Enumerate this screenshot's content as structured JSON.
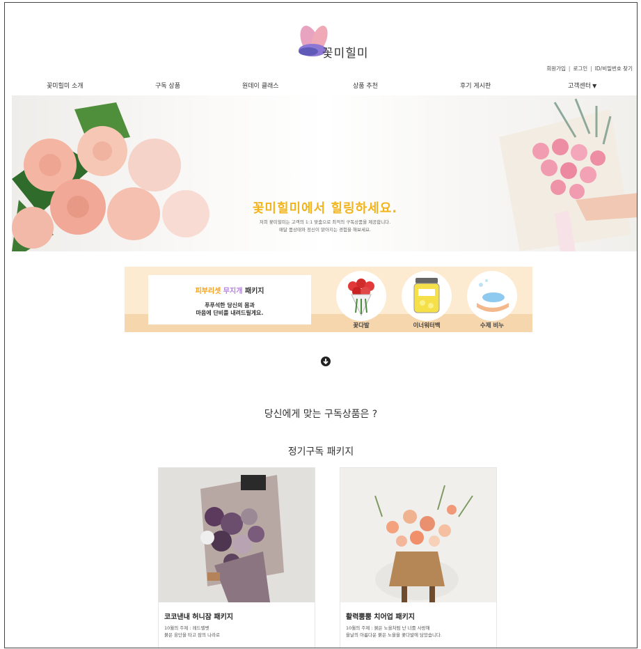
{
  "brand": {
    "name": "꽃미힐미"
  },
  "top_links": [
    "회원가입",
    "로그인",
    "ID/비밀번호 찾기"
  ],
  "nav": {
    "items": [
      "꽃미힐미 소개",
      "구독 상품",
      "원데이 클래스",
      "상품 추천",
      "후기 게시판"
    ],
    "dropdown": {
      "label": "고객센터",
      "icon": "caret-down-icon"
    }
  },
  "hero": {
    "title": "꽃미힐미에서 힐링하세요.",
    "line1": "저희 꽃미힐미는 고객의 1:1 맞춤으로 최적의 구독상품을 제공합니다.",
    "line2": "매달 몸상태와 정신이 맑아지는 경험을 해보세요."
  },
  "banner": {
    "title_part1": "피부리셋",
    "title_part2": "무지개",
    "title_part3": "패키지",
    "line1": "푸푸석한 당신의 몸과",
    "line2": "마음에 단비를 내려드릴게요.",
    "items": [
      {
        "label": "꽃다발",
        "icon": "bouquet-icon"
      },
      {
        "label": "이너워터백",
        "icon": "jar-icon"
      },
      {
        "label": "수제 비누",
        "icon": "soap-icon"
      }
    ]
  },
  "section": {
    "question": "당신에게 맞는 구독상품은 ?",
    "subtitle": "정기구독 패키지"
  },
  "products": [
    {
      "name": "코코낸내 허니잠 패키지",
      "desc1": "10월의 주제 : 레드벨벳",
      "desc2": "붉은 융단을 타고 잠의 나라로"
    },
    {
      "name": "활력뿜뿜 치어업 패키지",
      "desc1": "10월의 주제 : 붉은 노을처럼 난 너를 사랑해",
      "desc2": "을날의 아름다운 붉은 노을을 꽃다발에 담았습니다."
    }
  ],
  "colors": {
    "accent_yellow": "#f2b41c",
    "banner_bg": "#fdebd1",
    "banner_band": "#f6d6ad",
    "logo_pink": "#e98aa8",
    "logo_purple": "#7a63c8"
  }
}
